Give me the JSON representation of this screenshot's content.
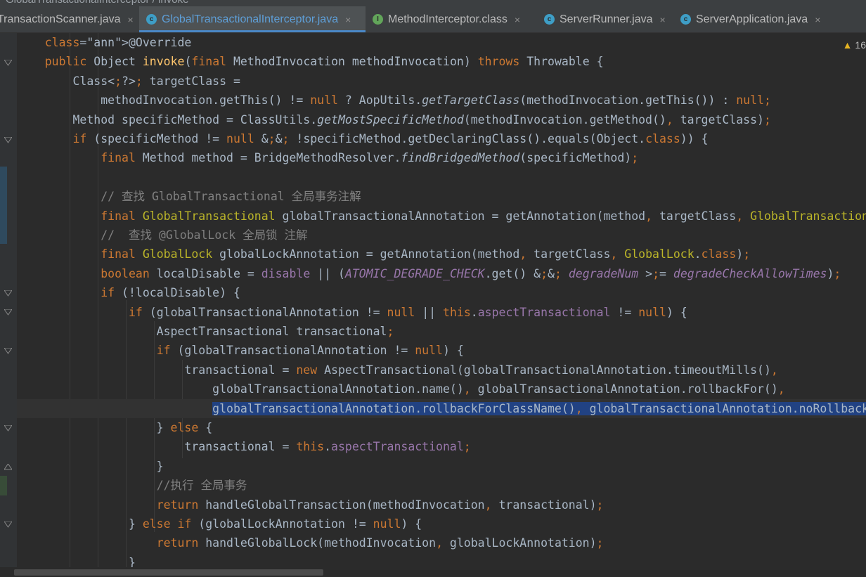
{
  "breadcrumb": {
    "text": "GlobalTransactionalInterceptor / invoke"
  },
  "tabs": [
    {
      "label": "TransactionScanner.java",
      "icon": "class-icon",
      "active": false
    },
    {
      "label": "GlobalTransactionalInterceptor.java",
      "icon": "class-icon",
      "active": true
    },
    {
      "label": "MethodInterceptor.class",
      "icon": "interface-icon",
      "active": false
    },
    {
      "label": "ServerRunner.java",
      "icon": "class-icon",
      "active": false
    },
    {
      "label": "ServerApplication.java",
      "icon": "spring-class-icon",
      "active": false
    }
  ],
  "close_glyph": "×",
  "warning": {
    "count": "16"
  },
  "code_lines": [
    "    @Override",
    "    public Object invoke(final MethodInvocation methodInvocation) throws Throwable {",
    "        Class<?> targetClass =",
    "            methodInvocation.getThis() != null ? AopUtils.getTargetClass(methodInvocation.getThis()) : null;",
    "        Method specificMethod = ClassUtils.getMostSpecificMethod(methodInvocation.getMethod(), targetClass);",
    "        if (specificMethod != null && !specificMethod.getDeclaringClass().equals(Object.class)) {",
    "            final Method method = BridgeMethodResolver.findBridgedMethod(specificMethod);",
    "",
    "            // 查找 GlobalTransactional 全局事务注解",
    "            final GlobalTransactional globalTransactionalAnnotation = getAnnotation(method, targetClass, GlobalTransactional.class);",
    "            //  查找 @GlobalLock 全局锁 注解",
    "            final GlobalLock globalLockAnnotation = getAnnotation(method, targetClass, GlobalLock.class);",
    "            boolean localDisable = disable || (ATOMIC_DEGRADE_CHECK.get() && degradeNum >= degradeCheckAllowTimes);",
    "            if (!localDisable) {",
    "                if (globalTransactionalAnnotation != null || this.aspectTransactional != null) {",
    "                    AspectTransactional transactional;",
    "                    if (globalTransactionalAnnotation != null) {",
    "                        transactional = new AspectTransactional(globalTransactionalAnnotation.timeoutMills(),",
    "                            globalTransactionalAnnotation.name(), globalTransactionalAnnotation.rollbackFor(),",
    "                            globalTransactionalAnnotation.rollbackForClassName(), globalTransactionalAnnotation.noRollbackFor(),",
    "                    } else {",
    "                        transactional = this.aspectTransactional;",
    "                    }",
    "                    //执行 全局事务",
    "                    return handleGlobalTransaction(methodInvocation, transactional);",
    "                } else if (globalLockAnnotation != null) {",
    "                    return handleGlobalLock(methodInvocation, globalLockAnnotation);",
    "                }"
  ]
}
